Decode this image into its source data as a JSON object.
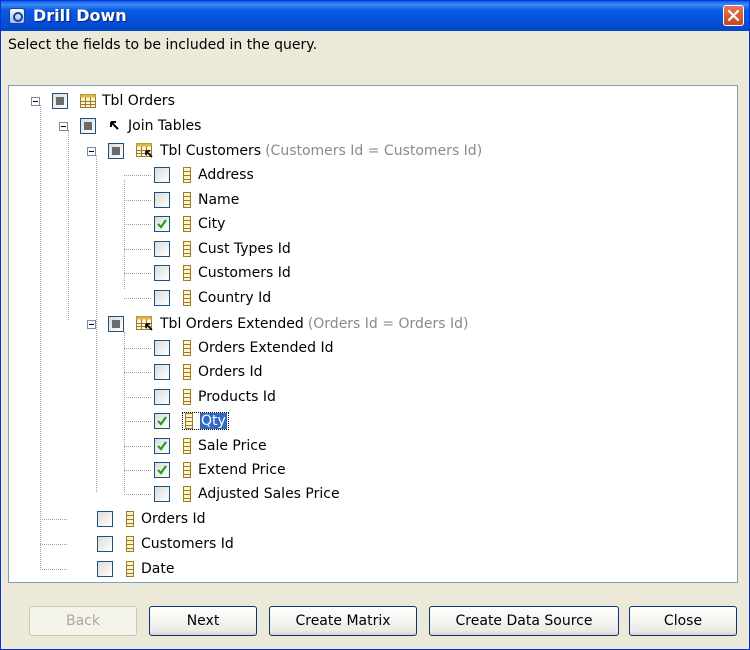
{
  "window": {
    "title": "Drill Down"
  },
  "instruction": "Select the fields to be included in the query.",
  "tree": {
    "root": "Tbl Orders",
    "join_tables": "Join Tables",
    "customers_table": {
      "name": "Tbl Customers",
      "join_note": "(Customers Id = Customers Id)"
    },
    "customers_fields": [
      "Address",
      "Name",
      "City",
      "Cust Types Id",
      "Customers Id",
      "Country Id"
    ],
    "orders_ext_table": {
      "name": "Tbl Orders Extended",
      "join_note": "(Orders Id = Orders Id)"
    },
    "orders_ext_fields": [
      "Orders Extended Id",
      "Orders Id",
      "Products Id",
      "Qty",
      "Sale Price",
      "Extend Price",
      "Adjusted Sales Price"
    ],
    "root_fields": [
      "Orders Id",
      "Customers Id",
      "Date"
    ],
    "checked_fields": [
      "City",
      "Qty",
      "Sale Price",
      "Extend Price"
    ],
    "selected_field": "Qty"
  },
  "buttons": {
    "back": "Back",
    "next": "Next",
    "create_matrix": "Create Matrix",
    "create_data_source": "Create Data Source",
    "close": "Close"
  },
  "colors": {
    "titlebar": "#0550da",
    "selection": "#316ac5",
    "check": "#21a121"
  }
}
